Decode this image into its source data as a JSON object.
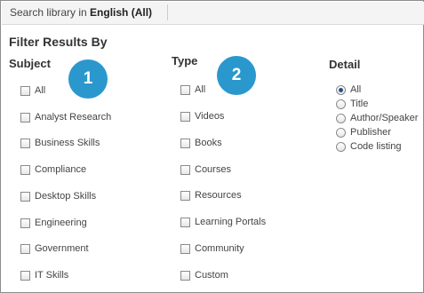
{
  "search": {
    "prefix": "Search library in ",
    "scope": "English (All)"
  },
  "filter_title": "Filter Results By",
  "subject": {
    "header": "Subject",
    "items": [
      "All",
      "Analyst Research",
      "Business Skills",
      "Compliance",
      "Desktop Skills",
      "Engineering",
      "Government",
      "IT Skills"
    ]
  },
  "type": {
    "header": "Type",
    "items": [
      "All",
      "Videos",
      "Books",
      "Courses",
      "Resources",
      "Learning Portals",
      "Community",
      "Custom"
    ]
  },
  "detail": {
    "header": "Detail",
    "selected": "All",
    "items": [
      "All",
      "Title",
      "Author/Speaker",
      "Publisher",
      "Code listing"
    ]
  },
  "callouts": [
    "1",
    "2"
  ],
  "colors": {
    "callout": "#2a98cd",
    "radio_dot": "#2a4e86"
  }
}
